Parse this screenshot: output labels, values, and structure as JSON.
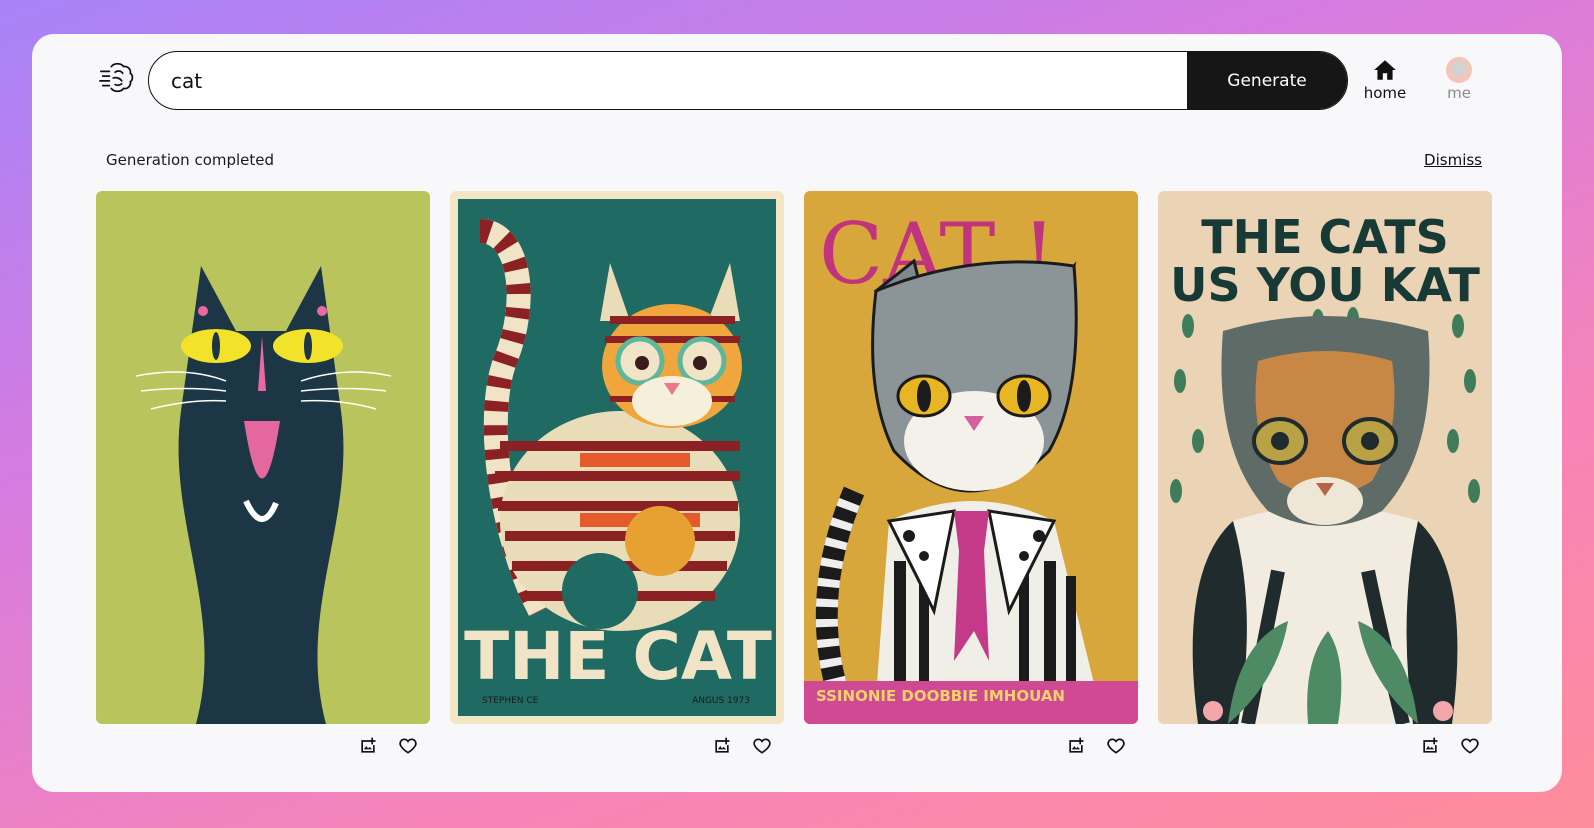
{
  "search": {
    "value": "cat",
    "generate_label": "Generate"
  },
  "nav": {
    "home_label": "home",
    "me_label": "me"
  },
  "status": {
    "message": "Generation completed",
    "dismiss_label": "Dismiss"
  },
  "images": [
    {
      "bg": "#b9c45c"
    },
    {
      "bg": "#1e6b62",
      "text": "THE CAT",
      "footer_left": "STEPHEN CE",
      "footer_right": "ANGUS 1973"
    },
    {
      "bg": "#d7a83c",
      "text": "CAT !",
      "banner": "SSINONIE  DOOBBIE IMHOUAN"
    },
    {
      "bg": "#ead3b3",
      "text_line1": "THE CATS",
      "text_line2": "US YOU KAT"
    }
  ]
}
